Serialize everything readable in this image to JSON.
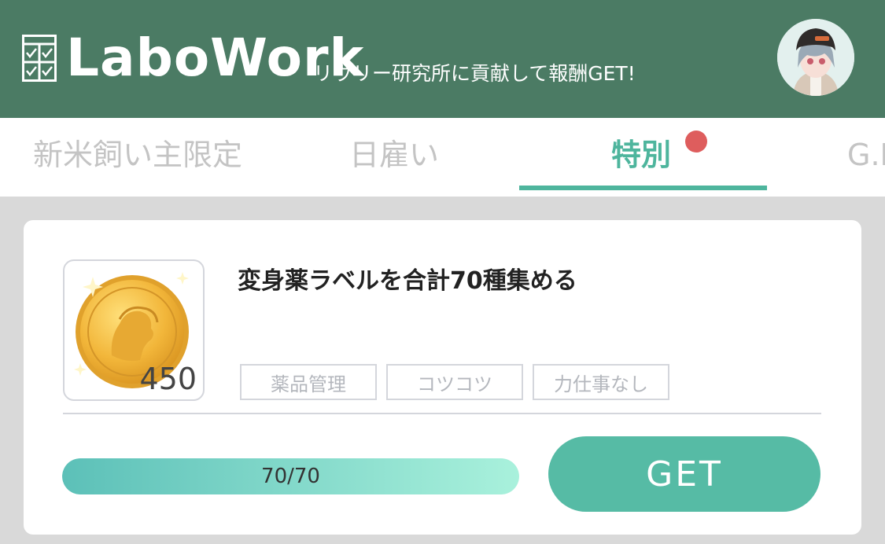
{
  "header": {
    "logo_text": "LaboWork",
    "tagline": "リヴリー研究所に貢献して報酬GET!",
    "logo_icon": "checklist-icon",
    "avatar": "user-avatar"
  },
  "tabs": [
    {
      "label": "新米飼い主限定",
      "active": false
    },
    {
      "label": "日雇い",
      "active": false
    },
    {
      "label": "特別",
      "active": true,
      "has_notification": true
    },
    {
      "label": "G.I",
      "active": false
    }
  ],
  "task": {
    "title": "変身薬ラベルを合計70種集める",
    "reward_icon": "gold-coin-icon",
    "reward_amount": "450",
    "tags": [
      "薬品管理",
      "コツコツ",
      "力仕事なし"
    ],
    "progress_text": "70/70",
    "progress_fraction": 1.0,
    "button_label": "GET"
  },
  "colors": {
    "header_bg": "#4b7b64",
    "accent": "#4eb59d",
    "button": "#56bba5",
    "notification": "#de5d5d"
  }
}
